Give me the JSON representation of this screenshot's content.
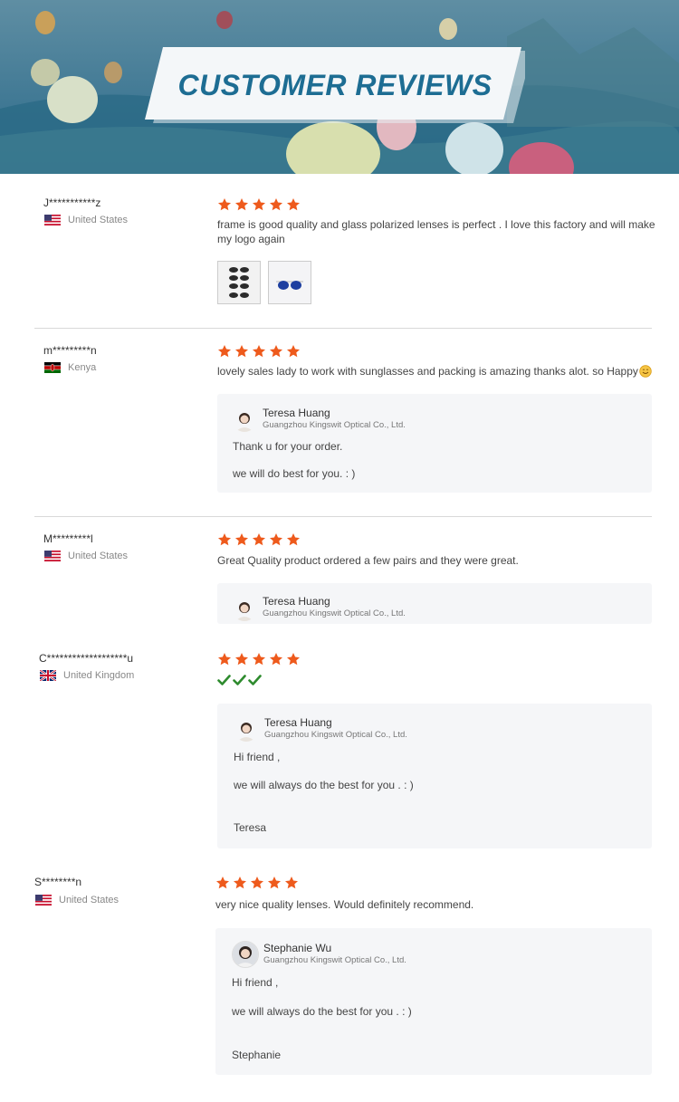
{
  "banner": {
    "title": "CUSTOMER REVIEWS"
  },
  "colors": {
    "star": "#ee5a1c",
    "check": "#2e8b2e",
    "title": "#1d6d93"
  },
  "reviews": [
    {
      "name": "J***********z",
      "country": "United States",
      "flag": "us-flag-icon",
      "rating": 5,
      "text": [
        "frame is good quality and glass polarized lenses is perfect . I love this factory and will make",
        "my logo again"
      ]
    },
    {
      "name": "m*********n",
      "country": "Kenya",
      "flag": "kenya-flag-icon",
      "rating": 5,
      "text": [
        "lovely sales lady to work with sunglasses and packing is amazing thanks alot. so Happy"
      ],
      "reply": {
        "name": "Teresa Huang",
        "company": "Guangzhou Kingswit Optical Co., Ltd.",
        "lines": [
          "Thank u for your order.",
          "we will do best for you. : )"
        ]
      }
    },
    {
      "name": "M*********l",
      "country": "United States",
      "flag": "us-flag-icon",
      "rating": 5,
      "text": [
        "Great Quality product ordered a few pairs and they were great."
      ],
      "reply": {
        "name": "Teresa Huang",
        "company": "Guangzhou Kingswit Optical Co., Ltd."
      }
    },
    {
      "name": "C*******************u",
      "country": "United Kingdom",
      "flag": "uk-flag-icon",
      "rating": 5,
      "reply": {
        "name": "Teresa Huang",
        "company": "Guangzhou Kingswit Optical Co., Ltd.",
        "lines": [
          "Hi friend ,",
          "we will always do the best for you .  : )",
          "Teresa"
        ]
      }
    },
    {
      "name": "S********n",
      "country": "United States",
      "flag": "us-flag-icon",
      "rating": 5,
      "text": [
        "very nice quality lenses. Would definitely recommend."
      ],
      "reply": {
        "name": "Stephanie Wu",
        "company": "Guangzhou Kingswit Optical Co., Ltd.",
        "lines": [
          "Hi friend ,",
          "we will always do the best for you .  : )",
          "Stephanie"
        ]
      }
    }
  ]
}
